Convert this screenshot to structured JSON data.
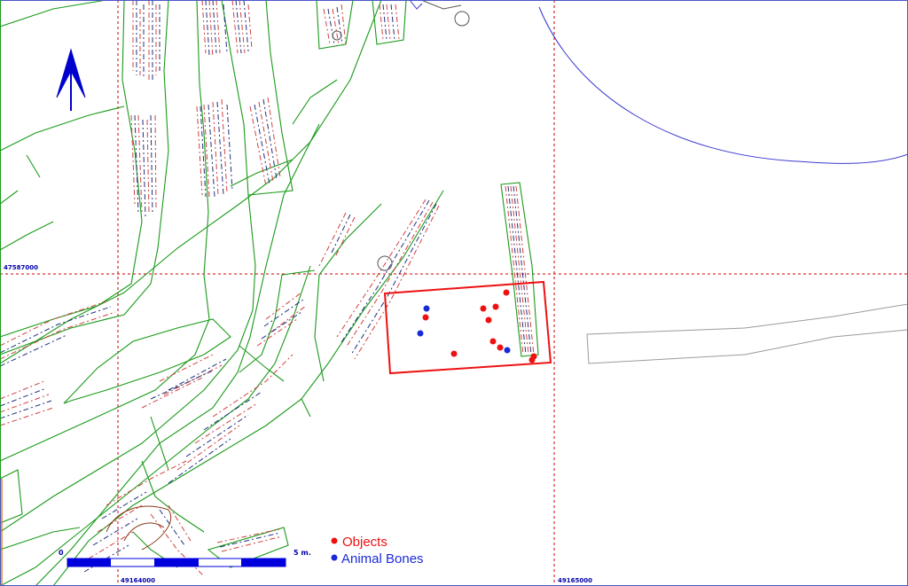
{
  "colors": {
    "frame": "#4b57c8",
    "grid": "#cc0000",
    "trench": "#1a9a1a",
    "hatch_red": "#d04040",
    "hatch_blue": "#203080",
    "objects": "#ee1111",
    "bones": "#1a2ad8",
    "boundary": "#3a3ad0",
    "gray": "#9a9a9a",
    "scale_bar": "#0000dd"
  },
  "north_arrow_icon": "north-arrow-icon",
  "grid_labels": {
    "northing": "47587000",
    "easting_left": "49164000",
    "easting_right": "49165000"
  },
  "scale": {
    "start": "0",
    "end": "5 m."
  },
  "legend": {
    "objects": "Objects",
    "animal_bones": "Animal Bones"
  },
  "finds": {
    "objects": [
      [
        571,
        330
      ],
      [
        545,
        348
      ],
      [
        559,
        346
      ],
      [
        480,
        358
      ],
      [
        551,
        361
      ],
      [
        556,
        385
      ],
      [
        564,
        392
      ],
      [
        512,
        399
      ],
      [
        602,
        402
      ],
      [
        600,
        406
      ]
    ],
    "animal_bones": [
      [
        481,
        348
      ],
      [
        474,
        376
      ],
      [
        572,
        395
      ]
    ]
  }
}
